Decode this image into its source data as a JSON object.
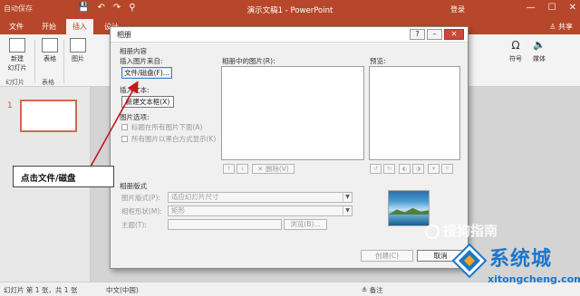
{
  "app": {
    "title": "演示文稿1 - PowerPoint",
    "login": "登录",
    "autosave": "自动保存",
    "quick_access": [
      "💾",
      "↶",
      "↷",
      "⚲"
    ],
    "window_buttons": [
      "—",
      "☐",
      "✕"
    ]
  },
  "ribbon": {
    "tabs": [
      "文件",
      "开始",
      "插入",
      "设计"
    ],
    "active_tab": "插入",
    "share": "共享",
    "groups": {
      "new_slide": "新建\n幻灯片",
      "table": "表格",
      "images": "图片",
      "symbol": "符号",
      "media": "媒体",
      "slides_label": "幻灯片",
      "tables_label": "表格"
    }
  },
  "slides_pane": {
    "slide_number": "1"
  },
  "status_bar": {
    "slide_info": "幻灯片 第 1 张，共 1 张",
    "language": "中文(中国)",
    "notes": "备注"
  },
  "dialog": {
    "title": "相册",
    "section_content": "相册内容",
    "insert_from": "插入图片来自:",
    "file_disk_button": "文件/磁盘(F)...",
    "insert_text": "插入文本:",
    "new_textbox_button": "新建文本框(X)",
    "picture_options": "图片选项:",
    "caption_below": "标题在所有图片下面(A)",
    "all_black_white": "所有图片以黑白方式显示(K)",
    "pictures_in_album": "相册中的图片(R):",
    "preview": "预览:",
    "remove_button": "删除(V)",
    "album_layout": "相册版式",
    "picture_layout_label": "图片版式(P):",
    "picture_layout_value": "适应幻灯片尺寸",
    "frame_shape_label": "相框形状(M):",
    "frame_shape_value": "矩形",
    "theme_label": "主题(T):",
    "browse_button": "浏览(B)...",
    "create_button": "创建(C)",
    "cancel_button": "取消"
  },
  "annotation": {
    "callout_text": "点击文件/磁盘"
  },
  "watermarks": {
    "sogou": "搜狗指南",
    "site_name": "系统城",
    "site_url": "xitongcheng.com"
  },
  "colors": {
    "accent": "#b7472a",
    "arrow": "#c4181d"
  }
}
